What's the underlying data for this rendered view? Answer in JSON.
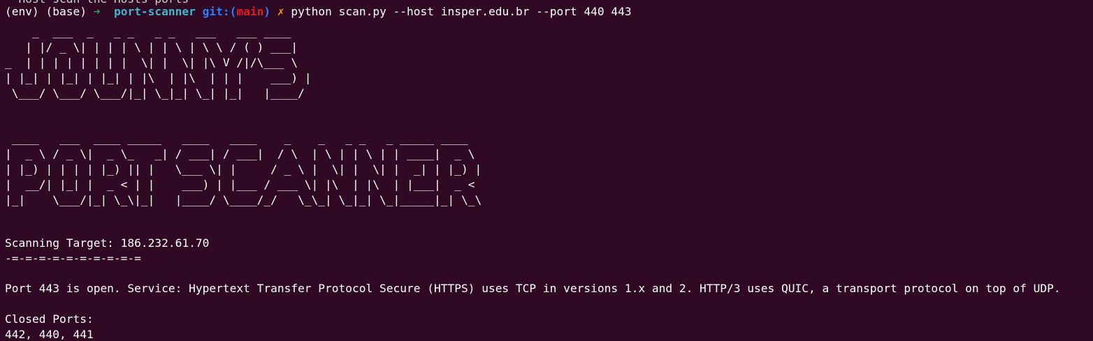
{
  "terminal": {
    "scrolled_line": "  Host scan the Hosts ports",
    "prompt": {
      "env": "(env) (base)",
      "arrow": "➜",
      "directory": "port-scanner",
      "git_label": "git:(",
      "branch": "main",
      "git_close": ")",
      "dirty_marker": "✗",
      "command": "python scan.py --host insper.edu.br --port 440 443"
    },
    "banner_line1": [
      "    _  ___  _   _ _   _ _   ___   ___ ____ ",
      "   | |/ _ \\| | | | \\ | | \\ | \\ \\ / ( ) ___|",
      "_  | | | | | | | |  \\| |  \\| |\\ V /|/\\___ \\",
      "| |_| | |_| | |_| | |\\  | |\\  | | |    ___) |",
      " \\___/ \\___/ \\___/|_| \\_|_| \\_| |_|   |____/ "
    ],
    "banner_line2": [
      " ____   ___  ____ _____   ____   ____    _    _   _ _   _ _____ ____  ",
      "|  _ \\ / _ \\|  _ \\_   _| / ___| / ___|  / \\  | \\ | | \\ | | ____|  _ \\ ",
      "| |_) | | | | |_) || |   \\___ \\| |     / _ \\ |  \\| |  \\| |  _| | |_) |",
      "|  __/| |_| |  _ < | |    ___) | |___ / ___ \\| |\\  | |\\  | |___|  _ < ",
      "|_|    \\___/|_| \\_\\|_|   |____/ \\____/_/   \\_\\_| \\_|_| \\_|_____|_| \\_\\"
    ],
    "scanning_target": "Scanning Target: 186.232.61.70",
    "separator": "-=-=-=-=-=-=-=-=-=-=",
    "open_port_message": "Port 443 is open. Service: Hypertext Transfer Protocol Secure (HTTPS) uses TCP in versions 1.x and 2. HTTP/3 uses QUIC, a transport protocol on top of UDP.",
    "closed_ports_label": "Closed Ports:",
    "closed_ports_list": "442, 440, 441"
  }
}
